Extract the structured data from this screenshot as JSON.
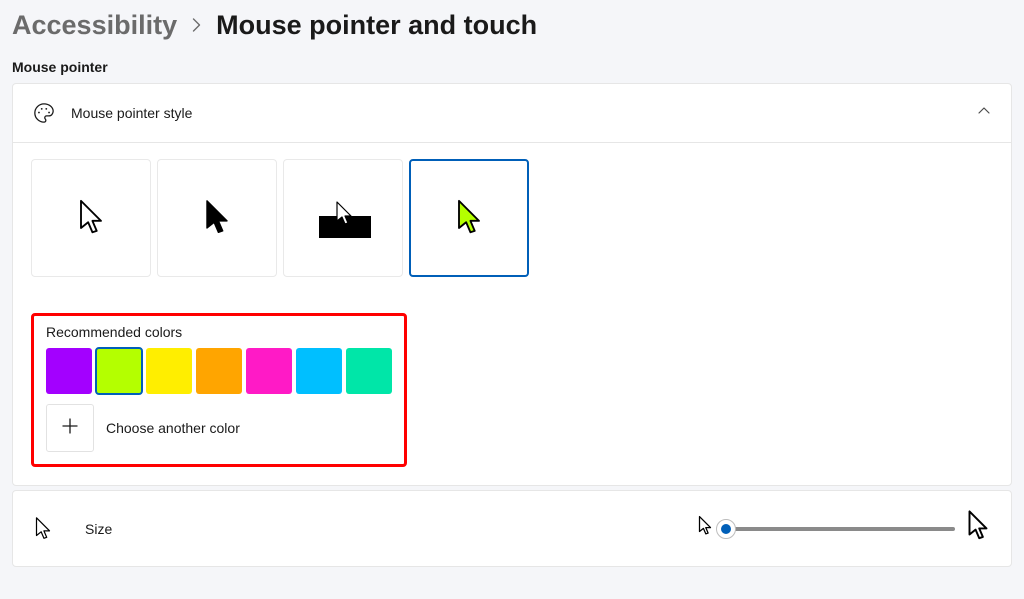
{
  "breadcrumb": {
    "parent": "Accessibility",
    "current": "Mouse pointer and touch"
  },
  "section_label": "Mouse pointer",
  "pointer_style": {
    "title": "Mouse pointer style",
    "expanded": true,
    "options": [
      {
        "id": "white",
        "selected": false
      },
      {
        "id": "black",
        "selected": false
      },
      {
        "id": "inverted",
        "selected": false
      },
      {
        "id": "custom",
        "selected": true
      }
    ]
  },
  "colors": {
    "title": "Recommended colors",
    "swatches": [
      {
        "hex": "#a300ff",
        "selected": false
      },
      {
        "hex": "#b4ff00",
        "selected": true
      },
      {
        "hex": "#ffee00",
        "selected": false
      },
      {
        "hex": "#ffa500",
        "selected": false
      },
      {
        "hex": "#ff1ac6",
        "selected": false
      },
      {
        "hex": "#00bfff",
        "selected": false
      },
      {
        "hex": "#00e6a8",
        "selected": false
      }
    ],
    "choose_label": "Choose another color"
  },
  "size": {
    "title": "Size",
    "value": 1,
    "min": 1,
    "max": 15
  }
}
